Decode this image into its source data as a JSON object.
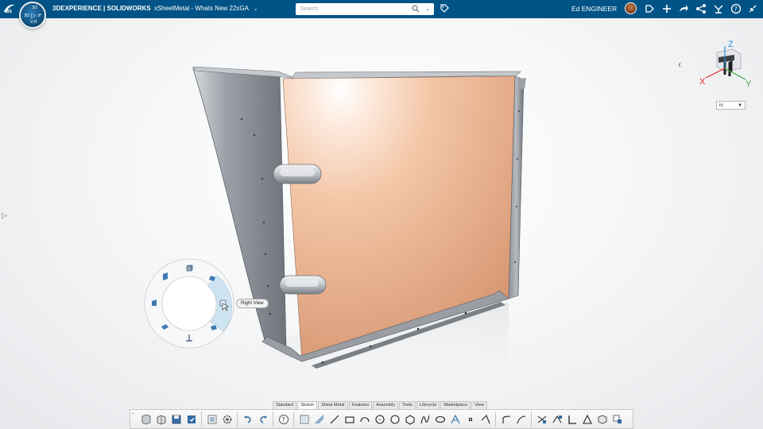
{
  "app": {
    "brand_bold": "3DEXPERIENCE | SOLIDWORKS",
    "document_title": "xSheetMetal - Whats New 22xGA",
    "compass": {
      "north": "3D",
      "west": "3D",
      "east": "iF",
      "south": "V,R"
    }
  },
  "search": {
    "placeholder": "Search",
    "value": ""
  },
  "user": {
    "name": "Ed ENGINEER"
  },
  "topbar_icons": [
    "share-tag-icon",
    "add-icon",
    "forward-share-icon",
    "network-share-icon",
    "tools-icon",
    "help-icon",
    "collapse-icon"
  ],
  "view_ring": {
    "tooltip": "Right View",
    "highlighted": "right-view"
  },
  "triad": {
    "x": "X",
    "y": "Y",
    "z": "Z",
    "x_color": "#e0202a",
    "y_color": "#3ba83b",
    "z_color": "#2a8fd6"
  },
  "units": {
    "value": "in"
  },
  "command_tabs": [
    "Standard",
    "Sketch",
    "Sheet Metal",
    "Features",
    "Assembly",
    "Tools",
    "Lifecycle",
    "Marketplace",
    "View"
  ],
  "active_tab": "Sketch",
  "colors": {
    "topbar": "#005386",
    "panel": "#f3c4a6",
    "metal": "#8a9099"
  }
}
